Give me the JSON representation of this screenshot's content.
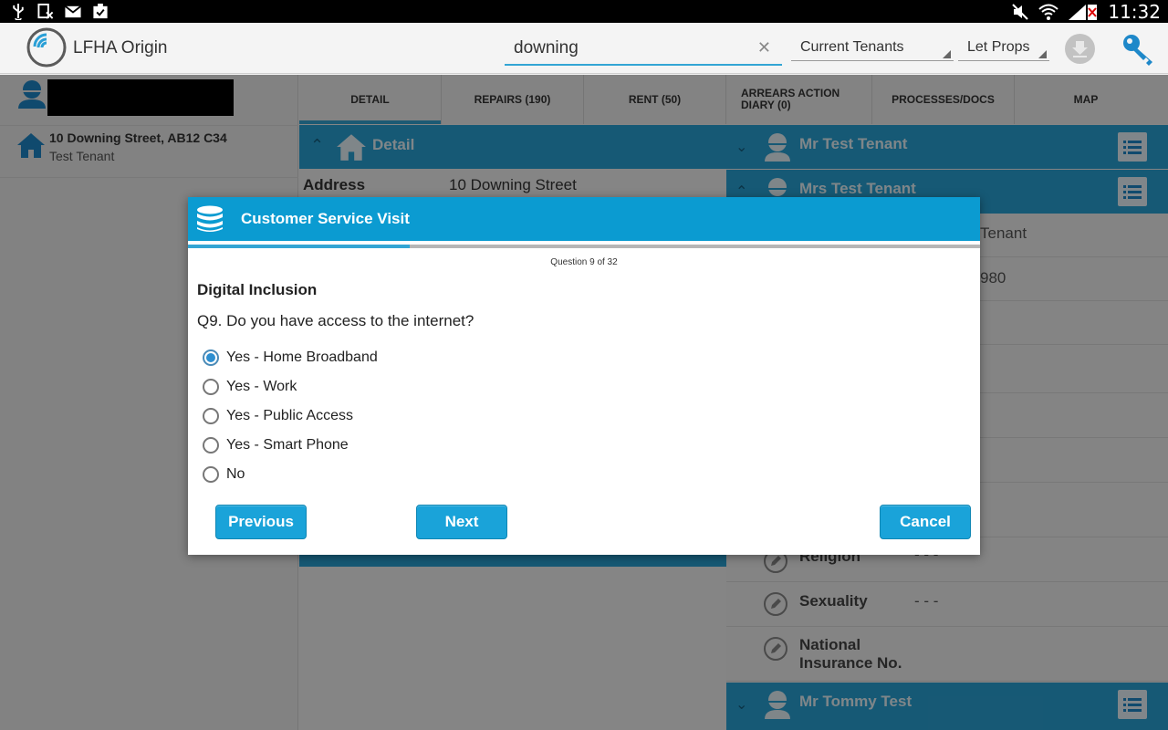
{
  "status_bar": {
    "time": "11:32"
  },
  "app": {
    "title": "LFHA Origin"
  },
  "search": {
    "value": "downing"
  },
  "filters": {
    "tenancy": "Current Tenants",
    "property": "Let Props"
  },
  "left_panel": {
    "property": {
      "address": "10 Downing Street, AB12 C34",
      "tenant": "Test Tenant"
    }
  },
  "tabs": [
    {
      "label": "DETAIL",
      "active": true
    },
    {
      "label": "REPAIRS (190)"
    },
    {
      "label": "RENT (50)"
    },
    {
      "label": "ARREARS ACTION\nDIARY (0)"
    },
    {
      "label": "PROCESSES/DOCS"
    },
    {
      "label": "MAP"
    }
  ],
  "detail": {
    "header": "Detail",
    "address_label": "Address",
    "address_value": "10 Downing Street"
  },
  "right_panel": {
    "tenants": [
      "Mr Test Tenant",
      "Mrs Test Tenant",
      "Mr Tommy Test"
    ],
    "fragments": [
      "Tenant",
      "980"
    ],
    "fields": [
      {
        "label": "Religion",
        "value": "- - -"
      },
      {
        "label": "Sexuality",
        "value": "- - -"
      },
      {
        "label": "National",
        "label2": "Insurance No.",
        "value": ""
      }
    ]
  },
  "dialog": {
    "title": "Customer Service Visit",
    "progress": 0.28,
    "counter": "Question 9 of 32",
    "section": "Digital Inclusion",
    "question": "Q9. Do you have access to the internet?",
    "options": [
      {
        "label": "Yes - Home Broadband",
        "selected": true
      },
      {
        "label": "Yes - Work",
        "selected": false
      },
      {
        "label": "Yes - Public Access",
        "selected": false
      },
      {
        "label": "Yes - Smart Phone",
        "selected": false
      },
      {
        "label": "No",
        "selected": false
      }
    ],
    "buttons": {
      "previous": "Previous",
      "next": "Next",
      "cancel": "Cancel"
    }
  },
  "colors": {
    "accent": "#29a3d6",
    "dialog_header": "#0b9bd1",
    "button": "#1aa3d9"
  }
}
